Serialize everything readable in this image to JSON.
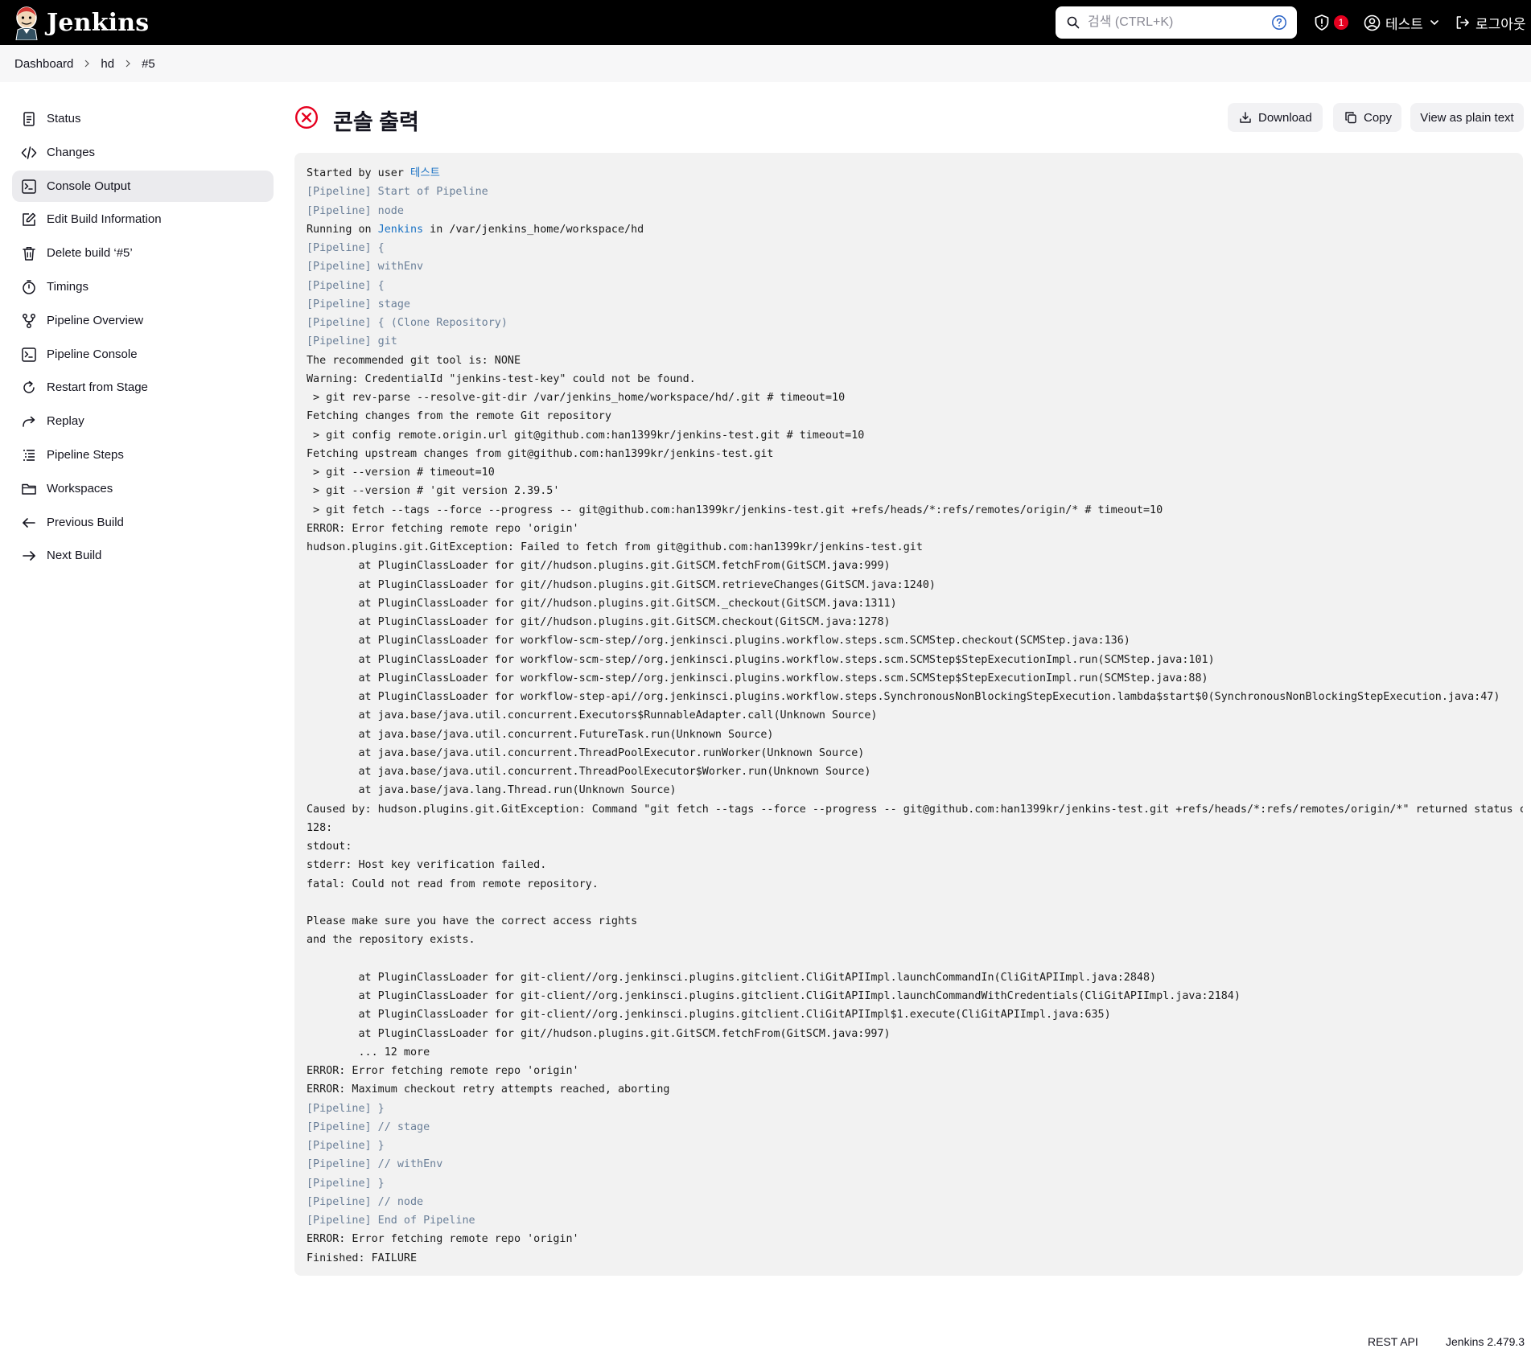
{
  "header": {
    "brand": "Jenkins",
    "search_placeholder": "검색 (CTRL+K)",
    "notification_count": "1",
    "user_name": "테스트",
    "logout_label": "로그아웃"
  },
  "breadcrumb": [
    "Dashboard",
    "hd",
    "#5"
  ],
  "sidebar": {
    "items": [
      {
        "label": "Status",
        "icon": "document-icon"
      },
      {
        "label": "Changes",
        "icon": "code-icon"
      },
      {
        "label": "Console Output",
        "icon": "terminal-icon",
        "active": true
      },
      {
        "label": "Edit Build Information",
        "icon": "edit-icon"
      },
      {
        "label": "Delete build ‘#5’",
        "icon": "trash-icon"
      },
      {
        "label": "Timings",
        "icon": "stopwatch-icon"
      },
      {
        "label": "Pipeline Overview",
        "icon": "git-branch-icon"
      },
      {
        "label": "Pipeline Console",
        "icon": "terminal-icon"
      },
      {
        "label": "Restart from Stage",
        "icon": "refresh-icon"
      },
      {
        "label": "Replay",
        "icon": "redo-icon"
      },
      {
        "label": "Pipeline Steps",
        "icon": "list-icon"
      },
      {
        "label": "Workspaces",
        "icon": "folder-icon"
      },
      {
        "label": "Previous Build",
        "icon": "arrow-left-icon"
      },
      {
        "label": "Next Build",
        "icon": "arrow-right-icon"
      }
    ]
  },
  "main": {
    "title": "콘솔 출력",
    "status": "failure",
    "buttons": {
      "download": "Download",
      "copy": "Copy",
      "plain": "View as plain text"
    }
  },
  "console": {
    "lines": [
      {
        "parts": [
          {
            "t": "Started by user "
          },
          {
            "t": "테스트",
            "link": true
          }
        ]
      },
      {
        "parts": [
          {
            "t": "[Pipeline] Start of Pipeline",
            "pl": true
          }
        ]
      },
      {
        "parts": [
          {
            "t": "[Pipeline] node",
            "pl": true
          }
        ]
      },
      {
        "parts": [
          {
            "t": "Running on "
          },
          {
            "t": "Jenkins",
            "link": true
          },
          {
            "t": " in /var/jenkins_home/workspace/hd"
          }
        ]
      },
      {
        "parts": [
          {
            "t": "[Pipeline] {",
            "pl": true
          }
        ]
      },
      {
        "parts": [
          {
            "t": "[Pipeline] withEnv",
            "pl": true
          }
        ]
      },
      {
        "parts": [
          {
            "t": "[Pipeline] {",
            "pl": true
          }
        ]
      },
      {
        "parts": [
          {
            "t": "[Pipeline] stage",
            "pl": true
          }
        ]
      },
      {
        "parts": [
          {
            "t": "[Pipeline] { (Clone Repository)",
            "pl": true
          }
        ]
      },
      {
        "parts": [
          {
            "t": "[Pipeline] git",
            "pl": true
          }
        ]
      },
      {
        "parts": [
          {
            "t": "The recommended git tool is: NONE"
          }
        ]
      },
      {
        "parts": [
          {
            "t": "Warning: CredentialId \"jenkins-test-key\" could not be found."
          }
        ]
      },
      {
        "parts": [
          {
            "t": " > git rev-parse --resolve-git-dir /var/jenkins_home/workspace/hd/.git # timeout=10"
          }
        ]
      },
      {
        "parts": [
          {
            "t": "Fetching changes from the remote Git repository"
          }
        ]
      },
      {
        "parts": [
          {
            "t": " > git config remote.origin.url git@github.com:han1399kr/jenkins-test.git # timeout=10"
          }
        ]
      },
      {
        "parts": [
          {
            "t": "Fetching upstream changes from git@github.com:han1399kr/jenkins-test.git"
          }
        ]
      },
      {
        "parts": [
          {
            "t": " > git --version # timeout=10"
          }
        ]
      },
      {
        "parts": [
          {
            "t": " > git --version # 'git version 2.39.5'"
          }
        ]
      },
      {
        "parts": [
          {
            "t": " > git fetch --tags --force --progress -- git@github.com:han1399kr/jenkins-test.git +refs/heads/*:refs/remotes/origin/* # timeout=10"
          }
        ]
      },
      {
        "parts": [
          {
            "t": "ERROR: Error fetching remote repo 'origin'"
          }
        ]
      },
      {
        "parts": [
          {
            "t": "hudson.plugins.git.GitException: Failed to fetch from git@github.com:han1399kr/jenkins-test.git"
          }
        ]
      },
      {
        "parts": [
          {
            "t": "\tat PluginClassLoader for git//hudson.plugins.git.GitSCM.fetchFrom(GitSCM.java:999)"
          }
        ]
      },
      {
        "parts": [
          {
            "t": "\tat PluginClassLoader for git//hudson.plugins.git.GitSCM.retrieveChanges(GitSCM.java:1240)"
          }
        ]
      },
      {
        "parts": [
          {
            "t": "\tat PluginClassLoader for git//hudson.plugins.git.GitSCM._checkout(GitSCM.java:1311)"
          }
        ]
      },
      {
        "parts": [
          {
            "t": "\tat PluginClassLoader for git//hudson.plugins.git.GitSCM.checkout(GitSCM.java:1278)"
          }
        ]
      },
      {
        "parts": [
          {
            "t": "\tat PluginClassLoader for workflow-scm-step//org.jenkinsci.plugins.workflow.steps.scm.SCMStep.checkout(SCMStep.java:136)"
          }
        ]
      },
      {
        "parts": [
          {
            "t": "\tat PluginClassLoader for workflow-scm-step//org.jenkinsci.plugins.workflow.steps.scm.SCMStep$StepExecutionImpl.run(SCMStep.java:101)"
          }
        ]
      },
      {
        "parts": [
          {
            "t": "\tat PluginClassLoader for workflow-scm-step//org.jenkinsci.plugins.workflow.steps.scm.SCMStep$StepExecutionImpl.run(SCMStep.java:88)"
          }
        ]
      },
      {
        "parts": [
          {
            "t": "\tat PluginClassLoader for workflow-step-api//org.jenkinsci.plugins.workflow.steps.SynchronousNonBlockingStepExecution.lambda$start$0(SynchronousNonBlockingStepExecution.java:47)"
          }
        ]
      },
      {
        "parts": [
          {
            "t": "\tat java.base/java.util.concurrent.Executors$RunnableAdapter.call(Unknown Source)"
          }
        ]
      },
      {
        "parts": [
          {
            "t": "\tat java.base/java.util.concurrent.FutureTask.run(Unknown Source)"
          }
        ]
      },
      {
        "parts": [
          {
            "t": "\tat java.base/java.util.concurrent.ThreadPoolExecutor.runWorker(Unknown Source)"
          }
        ]
      },
      {
        "parts": [
          {
            "t": "\tat java.base/java.util.concurrent.ThreadPoolExecutor$Worker.run(Unknown Source)"
          }
        ]
      },
      {
        "parts": [
          {
            "t": "\tat java.base/java.lang.Thread.run(Unknown Source)"
          }
        ]
      },
      {
        "parts": [
          {
            "t": "Caused by: hudson.plugins.git.GitException: Command \"git fetch --tags --force --progress -- git@github.com:han1399kr/jenkins-test.git +refs/heads/*:refs/remotes/origin/*\" returned status code"
          }
        ]
      },
      {
        "parts": [
          {
            "t": "128:"
          }
        ]
      },
      {
        "parts": [
          {
            "t": "stdout: "
          }
        ]
      },
      {
        "parts": [
          {
            "t": "stderr: Host key verification failed."
          }
        ]
      },
      {
        "parts": [
          {
            "t": "fatal: Could not read from remote repository."
          }
        ]
      },
      {
        "parts": [
          {
            "t": ""
          }
        ]
      },
      {
        "parts": [
          {
            "t": "Please make sure you have the correct access rights"
          }
        ]
      },
      {
        "parts": [
          {
            "t": "and the repository exists."
          }
        ]
      },
      {
        "parts": [
          {
            "t": ""
          }
        ]
      },
      {
        "parts": [
          {
            "t": "\tat PluginClassLoader for git-client//org.jenkinsci.plugins.gitclient.CliGitAPIImpl.launchCommandIn(CliGitAPIImpl.java:2848)"
          }
        ]
      },
      {
        "parts": [
          {
            "t": "\tat PluginClassLoader for git-client//org.jenkinsci.plugins.gitclient.CliGitAPIImpl.launchCommandWithCredentials(CliGitAPIImpl.java:2184)"
          }
        ]
      },
      {
        "parts": [
          {
            "t": "\tat PluginClassLoader for git-client//org.jenkinsci.plugins.gitclient.CliGitAPIImpl$1.execute(CliGitAPIImpl.java:635)"
          }
        ]
      },
      {
        "parts": [
          {
            "t": "\tat PluginClassLoader for git//hudson.plugins.git.GitSCM.fetchFrom(GitSCM.java:997)"
          }
        ]
      },
      {
        "parts": [
          {
            "t": "\t... 12 more"
          }
        ]
      },
      {
        "parts": [
          {
            "t": "ERROR: Error fetching remote repo 'origin'"
          }
        ]
      },
      {
        "parts": [
          {
            "t": "ERROR: Maximum checkout retry attempts reached, aborting"
          }
        ]
      },
      {
        "parts": [
          {
            "t": "[Pipeline] }",
            "pl": true
          }
        ]
      },
      {
        "parts": [
          {
            "t": "[Pipeline] // stage",
            "pl": true
          }
        ]
      },
      {
        "parts": [
          {
            "t": "[Pipeline] }",
            "pl": true
          }
        ]
      },
      {
        "parts": [
          {
            "t": "[Pipeline] // withEnv",
            "pl": true
          }
        ]
      },
      {
        "parts": [
          {
            "t": "[Pipeline] }",
            "pl": true
          }
        ]
      },
      {
        "parts": [
          {
            "t": "[Pipeline] // node",
            "pl": true
          }
        ]
      },
      {
        "parts": [
          {
            "t": "[Pipeline] End of Pipeline",
            "pl": true
          }
        ]
      },
      {
        "parts": [
          {
            "t": "ERROR: Error fetching remote repo 'origin'"
          }
        ]
      },
      {
        "parts": [
          {
            "t": "Finished: FAILURE"
          }
        ]
      }
    ]
  },
  "footer": {
    "rest_api": "REST API",
    "version": "Jenkins 2.479.3"
  },
  "colors": {
    "header_bg": "#000000",
    "failure_red": "#e6001f",
    "link_blue": "#1a72c4",
    "pipeline_gray": "#6a7f98",
    "console_bg": "#f2f2f2"
  }
}
